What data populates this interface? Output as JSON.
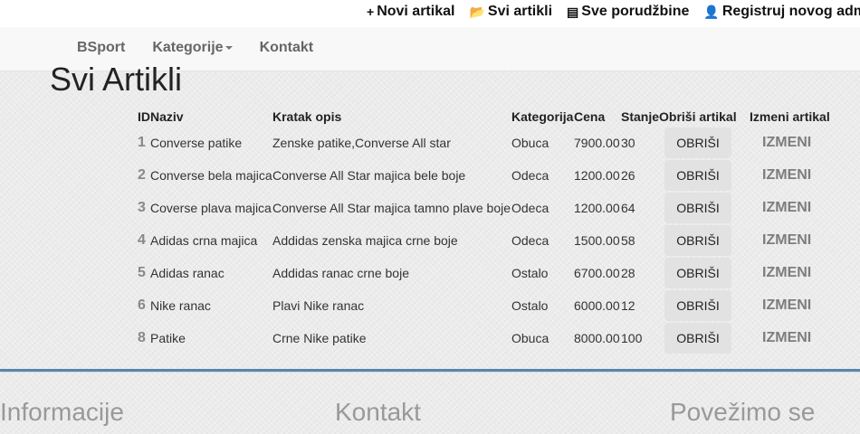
{
  "topbar": {
    "links": [
      {
        "icon": "plus-icon",
        "glyph": "+",
        "label": "Novi artikal"
      },
      {
        "icon": "folder-open-icon",
        "glyph": "📂",
        "label": "Svi artikli"
      },
      {
        "icon": "list-icon",
        "glyph": "▤",
        "label": "Sve porudžbine"
      },
      {
        "icon": "user-icon",
        "glyph": "👤",
        "label": "Registruj novog adm"
      }
    ]
  },
  "navbar": {
    "brand": "BSport",
    "categories": "Kategorije",
    "contact": "Kontakt"
  },
  "page": {
    "title": "Svi Artikli"
  },
  "table": {
    "headers": [
      "ID",
      "Naziv",
      "Kratak opis",
      "Kategorija",
      "Cena",
      "Stanje",
      "Obriši artikal",
      "Izmeni artikal"
    ],
    "delete_label": "OBRIŠI",
    "edit_label": "IZMENI",
    "rows": [
      {
        "id": "1",
        "name": "Converse patike",
        "desc": "Zenske patike,Converse All star",
        "cat": "Obuca",
        "price": "7900.00",
        "stock": "30"
      },
      {
        "id": "2",
        "name": "Converse bela majica",
        "desc": "Converse All Star majica bele boje",
        "cat": "Odeca",
        "price": "1200.00",
        "stock": "26"
      },
      {
        "id": "3",
        "name": "Coverse plava majica",
        "desc": "Converse All Star majica tamno plave boje",
        "cat": "Odeca",
        "price": "1200.00",
        "stock": "64"
      },
      {
        "id": "4",
        "name": "Adidas crna majica",
        "desc": "Addidas zenska majica crne boje",
        "cat": "Odeca",
        "price": "1500.00",
        "stock": "58"
      },
      {
        "id": "5",
        "name": "Adidas ranac",
        "desc": "Addidas ranac crne boje",
        "cat": "Ostalo",
        "price": "6700.00",
        "stock": "28"
      },
      {
        "id": "6",
        "name": "Nike ranac",
        "desc": "Plavi Nike ranac",
        "cat": "Ostalo",
        "price": "6000.00",
        "stock": "12"
      },
      {
        "id": "8",
        "name": "Patike",
        "desc": "Crne Nike patike",
        "cat": "Obuca",
        "price": "8000.00",
        "stock": "100"
      }
    ]
  },
  "footer": {
    "info": "Informacije",
    "contact": "Kontakt",
    "connect": "Povežimo se"
  }
}
